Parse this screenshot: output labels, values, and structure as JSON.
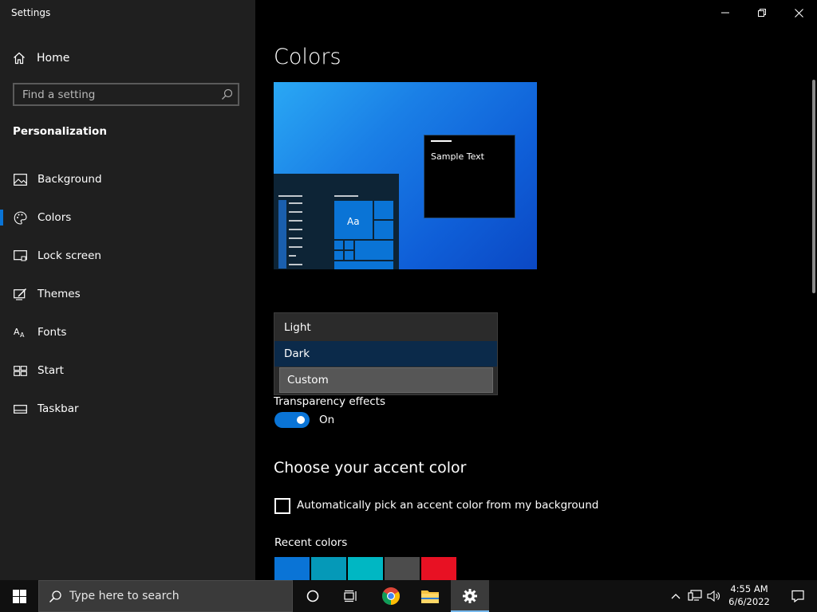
{
  "window": {
    "title": "Settings"
  },
  "sidebar": {
    "home_label": "Home",
    "search_placeholder": "Find a setting",
    "section_title": "Personalization",
    "items": [
      {
        "label": "Background",
        "icon": "picture-icon"
      },
      {
        "label": "Colors",
        "icon": "palette-icon",
        "active": true
      },
      {
        "label": "Lock screen",
        "icon": "lock-screen-icon"
      },
      {
        "label": "Themes",
        "icon": "themes-icon"
      },
      {
        "label": "Fonts",
        "icon": "fonts-icon"
      },
      {
        "label": "Start",
        "icon": "start-icon"
      },
      {
        "label": "Taskbar",
        "icon": "taskbar-icon"
      }
    ]
  },
  "main": {
    "title": "Colors",
    "preview": {
      "sample_text": "Sample Text",
      "tile_text": "Aa"
    },
    "color_mode_dropdown": {
      "options": [
        "Light",
        "Dark",
        "Custom"
      ],
      "selected": "Dark",
      "hovered": "Custom"
    },
    "transparency": {
      "label": "Transparency effects",
      "state": "On",
      "enabled": true
    },
    "accent": {
      "title": "Choose your accent color",
      "auto_pick_label": "Automatically pick an accent color from my background",
      "auto_pick_checked": false,
      "recent_label": "Recent colors",
      "recent_colors": [
        "#0a74d6",
        "#0599b8",
        "#00b7c3",
        "#4c4c4c",
        "#e81123"
      ]
    }
  },
  "taskbar": {
    "search_placeholder": "Type here to search",
    "clock_time": "4:55 AM",
    "clock_date": "6/6/2022"
  },
  "colors": {
    "accent": "#0a74d6",
    "sidebar_bg": "#1f1f1f",
    "main_bg": "#000000"
  }
}
